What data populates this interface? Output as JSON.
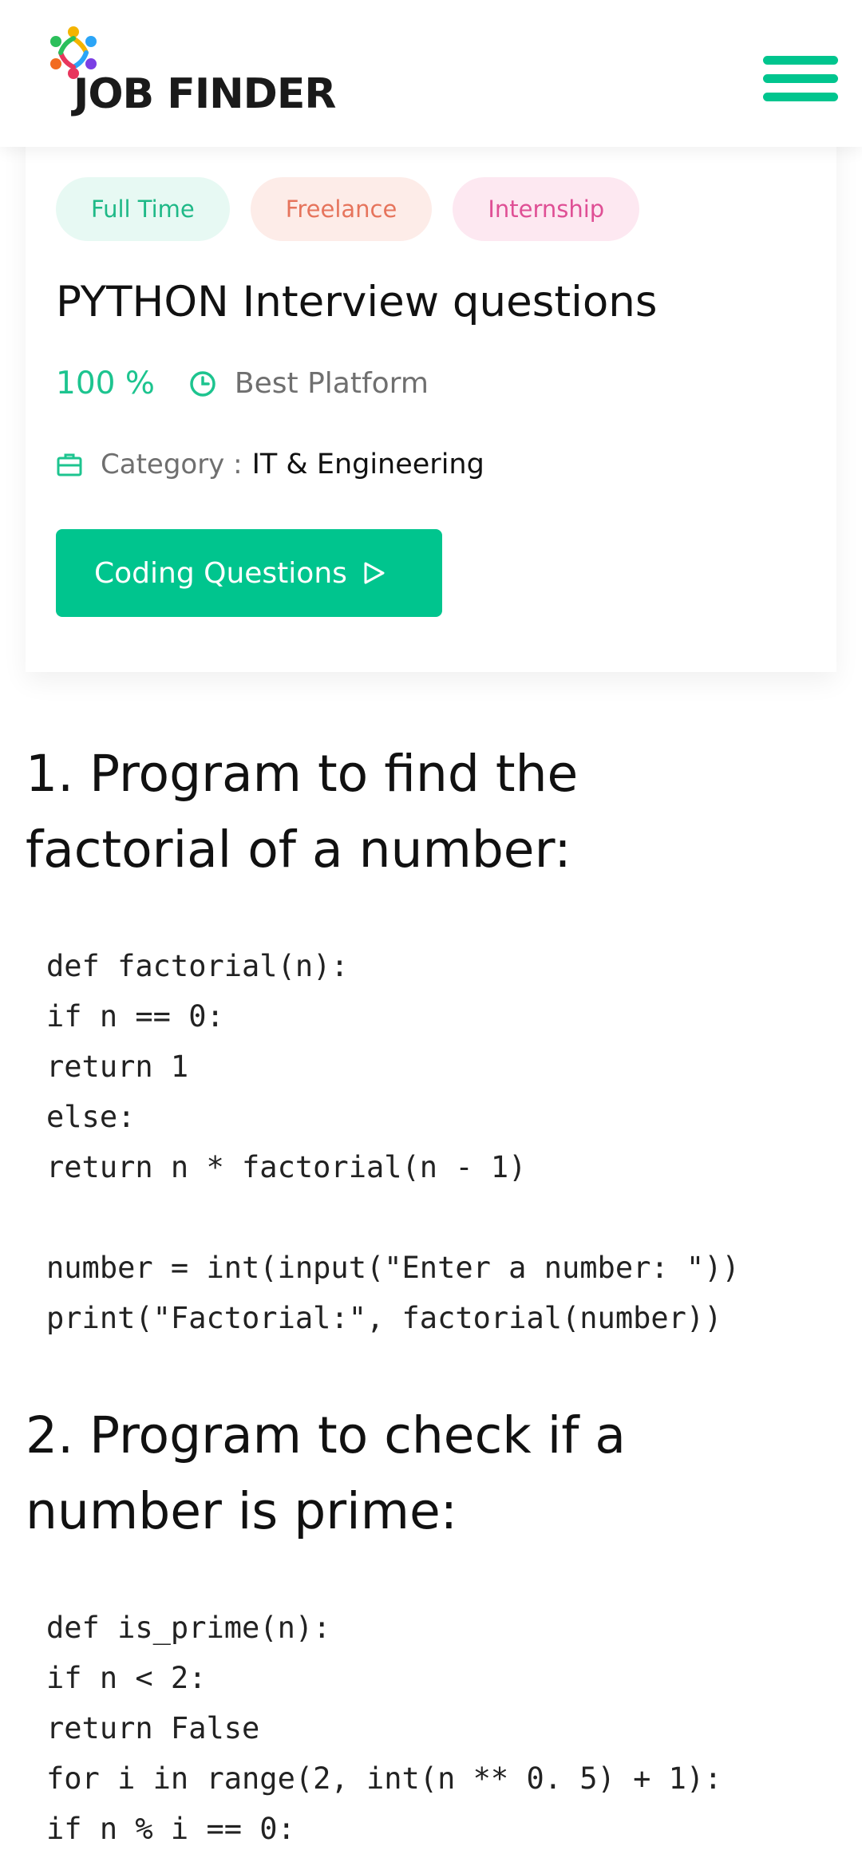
{
  "header": {
    "logo_text": "JOB FINDER",
    "menu_icon": "hamburger-menu-icon",
    "accent_color": "#00c58e"
  },
  "job": {
    "tags": [
      "Full Time",
      "Freelance",
      "Internship"
    ],
    "title": "PYTHON Interview questions",
    "percent": "100 %",
    "platform": "Best Platform",
    "category_label": "Category :",
    "category_value": "IT & Engineering",
    "button_label": "Coding Questions"
  },
  "questions": [
    {
      "heading_line1": "1. Program to find the",
      "heading_line2": "factorial of a number:",
      "code": [
        "def factorial(n):",
        "if n == 0:",
        "return 1",
        "else:",
        "return n * factorial(n - 1)",
        "",
        "number = int(input(\"Enter a number: \"))",
        "print(\"Factorial:\", factorial(number))"
      ]
    },
    {
      "heading_line1": "2. Program to check if a",
      "heading_line2": "number is prime:",
      "code": [
        "def is_prime(n):",
        "if n < 2:",
        "return False",
        "for i in range(2, int(n ** 0. 5) + 1):",
        "if n % i == 0:"
      ]
    }
  ]
}
